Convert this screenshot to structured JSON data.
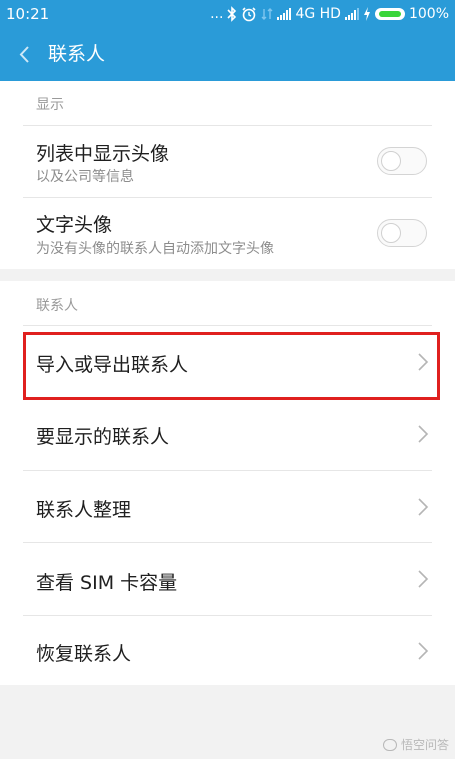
{
  "status_bar": {
    "time": "10:21",
    "dots": "...",
    "network": "4G HD",
    "battery": "100%"
  },
  "app_bar": {
    "title": "联系人"
  },
  "section_display": {
    "header": "显示",
    "items": [
      {
        "title": "列表中显示头像",
        "subtitle": "以及公司等信息",
        "toggle_on": false
      },
      {
        "title": "文字头像",
        "subtitle": "为没有头像的联系人自动添加文字头像",
        "toggle_on": false
      }
    ]
  },
  "section_contacts": {
    "header": "联系人",
    "items": [
      {
        "title": "导入或导出联系人"
      },
      {
        "title": "要显示的联系人"
      },
      {
        "title": "联系人整理"
      },
      {
        "title": "查看 SIM 卡容量"
      },
      {
        "title": "恢复联系人"
      }
    ]
  },
  "watermark": {
    "text": "悟空问答"
  },
  "colors": {
    "accent": "#2a9bd8",
    "highlight": "#e0201f",
    "battery": "#3ad53a"
  }
}
